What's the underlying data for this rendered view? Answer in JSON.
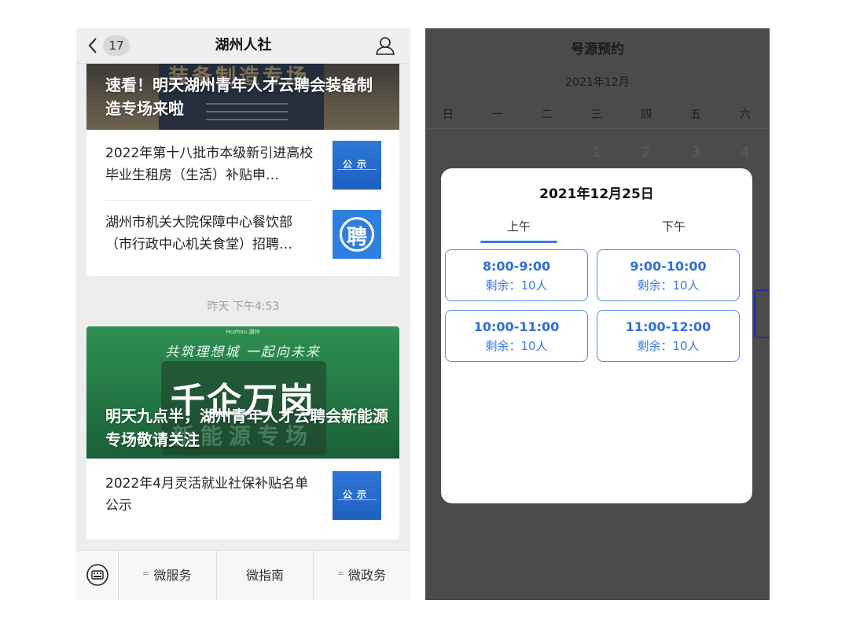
{
  "left_phone": {
    "header": {
      "badge_count": "17",
      "title": "湖州人社"
    },
    "card1": {
      "cover": {
        "headline": "速看！明天湖州青年人才云聘会装备制造专场来啦",
        "banner_text": "装备制造专场"
      },
      "items": [
        {
          "text": "2022年第十八批市本级新引进高校毕业生租房（生活）补贴申…",
          "thumb_label": "公示"
        },
        {
          "text": "湖州市机关大院保障中心餐饮部（市行政中心机关食堂）招聘…",
          "thumb_label": "聘"
        }
      ]
    },
    "timestamp": "昨天 下午4:53",
    "card2": {
      "cover": {
        "brand": "Huzhou 湖州",
        "slogan": "共筑理想城 一起向未来",
        "big_text": "千企万岗",
        "sub_text": "新能源专场",
        "headline": "明天九点半，湖州青年人才云聘会新能源专场敬请关注"
      },
      "items": [
        {
          "text": "2022年4月灵活就业社保补贴名单公示",
          "thumb_label": "公示"
        }
      ]
    },
    "bottom_menu": [
      "微服务",
      "微指南",
      "微政务"
    ]
  },
  "right_phone": {
    "title": "号源预约",
    "month": "2021年12月",
    "weekdays": [
      "日",
      "一",
      "二",
      "三",
      "四",
      "五",
      "六"
    ],
    "first_row_days": [
      "1",
      "2",
      "3",
      "4"
    ],
    "modal": {
      "date": "2021年12月25日",
      "tabs": [
        "上午",
        "下午"
      ],
      "active_tab": "上午",
      "slots": [
        {
          "time": "8:00-9:00",
          "remaining": "剩余：10人"
        },
        {
          "time": "9:00-10:00",
          "remaining": "剩余：10人"
        },
        {
          "time": "10:00-11:00",
          "remaining": "剩余：10人"
        },
        {
          "time": "11:00-12:00",
          "remaining": "剩余：10人"
        }
      ]
    }
  },
  "colors": {
    "accent_blue": "#3a7be0",
    "overlay_gray": "#4b4b4b",
    "wechat_bg": "#ededed"
  }
}
